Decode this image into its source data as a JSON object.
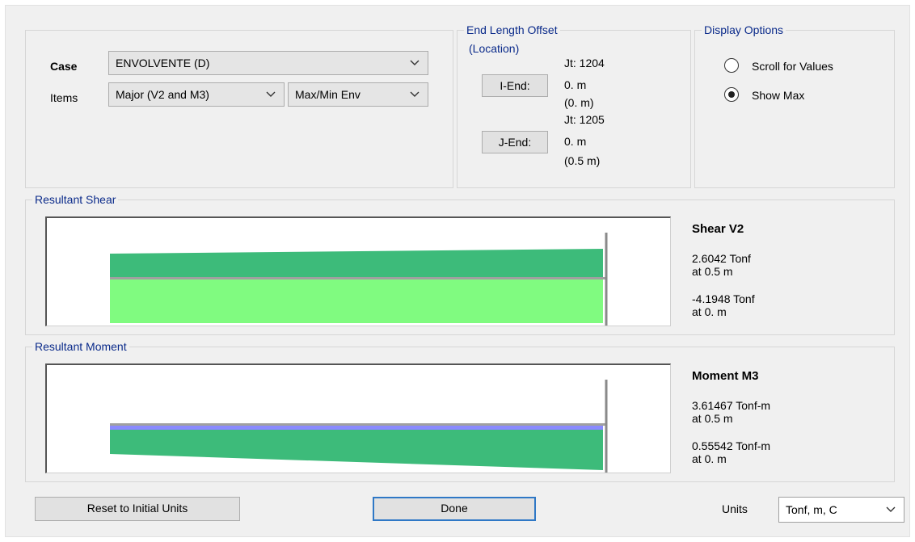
{
  "case_section": {
    "case_label": "Case",
    "case_value": "ENVOLVENTE (D)",
    "items_label": "Items",
    "items_value": "Major (V2 and M3)",
    "env_value": "Max/Min Env"
  },
  "end_length_offset": {
    "title": "End Length Offset",
    "location_label": "(Location)",
    "i_end": {
      "button": "I-End:",
      "joint": "Jt:  1204",
      "offset": "0. m",
      "location": "(0. m)"
    },
    "j_end": {
      "button": "J-End:",
      "joint": "Jt:  1205",
      "offset": "0. m",
      "location": "(0.5 m)"
    }
  },
  "display_options": {
    "title": "Display Options",
    "options": [
      {
        "label": "Scroll for Values",
        "selected": false
      },
      {
        "label": "Show Max",
        "selected": true
      }
    ]
  },
  "shear": {
    "group_title": "Resultant Shear",
    "heading": "Shear V2",
    "max_value": "2.6042 Tonf",
    "max_location": "at 0.5 m",
    "min_value": "-4.1948 Tonf",
    "min_location": "at 0. m"
  },
  "moment": {
    "group_title": "Resultant Moment",
    "heading": "Moment M3",
    "max_value": "3.61467 Tonf-m",
    "max_location": "at 0.5 m",
    "min_value": "0.55542 Tonf-m",
    "min_location": "at 0. m"
  },
  "footer": {
    "reset_button": "Reset to Initial Units",
    "done_button": "Done",
    "units_label": "Units",
    "units_value": "Tonf, m, C"
  },
  "colors": {
    "positive_fill": "#3dbb7a",
    "negative_fill": "#80fb80",
    "moment_negative_fill": "#8a8aff",
    "axis_line": "#a0a0a0",
    "group_title": "#0a2a8a"
  },
  "icons": [
    "chevron-down-icon"
  ]
}
